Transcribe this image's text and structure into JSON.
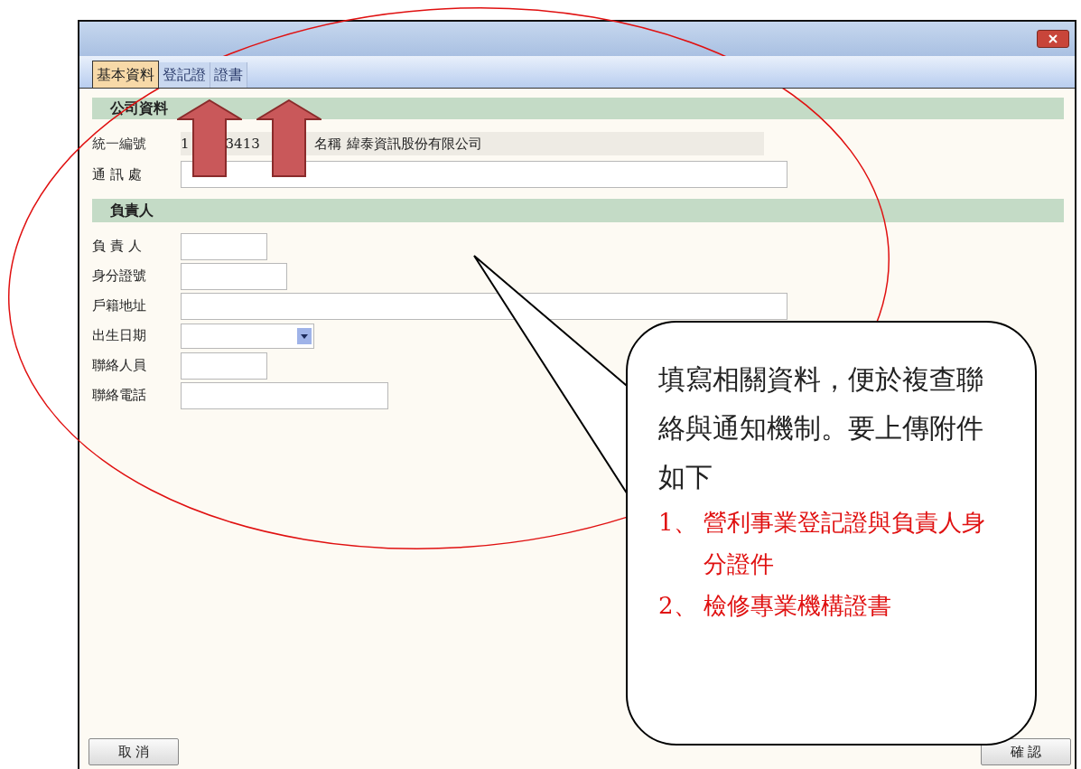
{
  "tabs": [
    {
      "label": "基本資料",
      "selected": true
    },
    {
      "label": "登記證",
      "selected": false
    },
    {
      "label": "證書",
      "selected": false
    }
  ],
  "company_section": {
    "title": "公司資料",
    "id_label": "統一編號",
    "id_value_parts": [
      "1",
      "3413"
    ],
    "name_label": "名稱",
    "name_value": "緯泰資訊股份有限公司",
    "address_label": "通 訊 處"
  },
  "owner_section": {
    "title": "負責人",
    "fields": [
      {
        "label": "負 責 人",
        "kind": "text"
      },
      {
        "label": "身分證號",
        "kind": "text"
      },
      {
        "label": "戶籍地址",
        "kind": "text"
      },
      {
        "label": "出生日期",
        "kind": "date"
      },
      {
        "label": "聯絡人員",
        "kind": "text"
      },
      {
        "label": "聯絡電話",
        "kind": "text"
      }
    ]
  },
  "buttons": {
    "cancel": "取 消",
    "confirm": "確 認"
  },
  "callout": {
    "text": "填寫相關資料，便於複查聯絡與通知機制。要上傳附件",
    "subtext": "如下",
    "items": [
      {
        "number": "1、",
        "text": "營利事業登記證與負責人身分證件"
      },
      {
        "number": "2、",
        "text": "檢修專業機構證書"
      }
    ]
  }
}
